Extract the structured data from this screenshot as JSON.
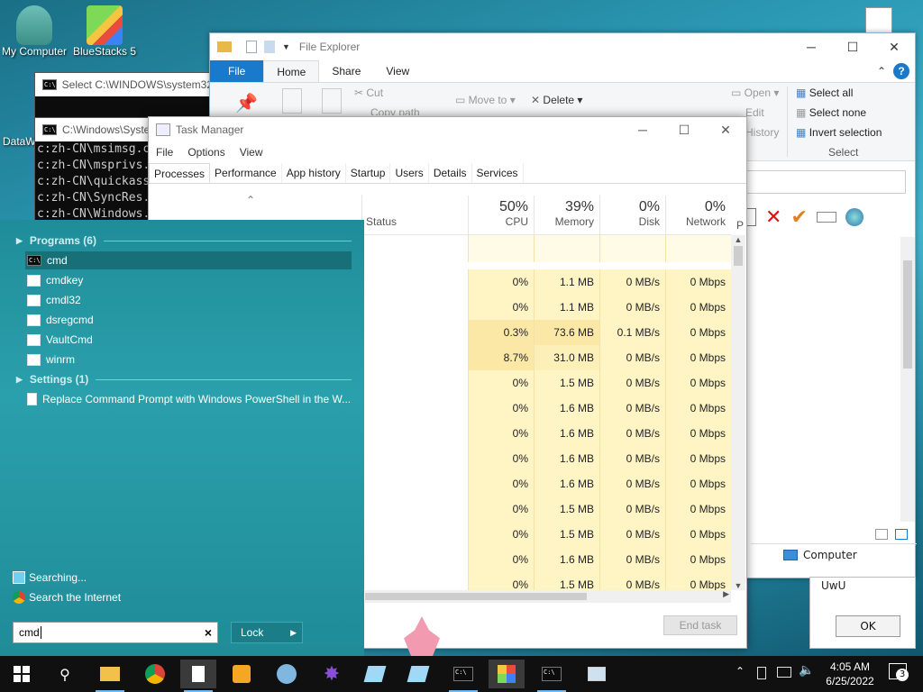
{
  "desktop": {
    "icons": [
      {
        "label": "My Computer"
      },
      {
        "label": "BlueStacks 5"
      },
      {
        "label": "DataW"
      }
    ]
  },
  "console_select": {
    "title": "Select C:\\WINDOWS\\system32\\"
  },
  "console_main": {
    "title": "C:\\Windows\\Syste",
    "lines": [
      "c:zh-CN\\msimsg.c",
      "c:zh-CN\\msprivs.",
      "c:zh-CN\\quickass",
      "c:zh-CN\\SyncRes.",
      "c:zh-CN\\Windows."
    ]
  },
  "explorer": {
    "title": "File Explorer",
    "tabs": {
      "file": "File",
      "home": "Home",
      "share": "Share",
      "view": "View"
    },
    "ribbon": {
      "cut": "Cut",
      "copy_path": "Copy path",
      "move_to": "Move to",
      "delete": "Delete",
      "open": "Open",
      "edit": "Edit",
      "history": "History",
      "select_all": "Select all",
      "select_none": "Select none",
      "invert_selection": "Invert selection",
      "select_group": "Select"
    },
    "nav_computer": "Computer"
  },
  "task_manager": {
    "title": "Task Manager",
    "menu": {
      "file": "File",
      "options": "Options",
      "view": "View"
    },
    "tabs": [
      "Processes",
      "Performance",
      "App history",
      "Startup",
      "Users",
      "Details",
      "Services"
    ],
    "columns": {
      "status": "Status",
      "cpu": {
        "pct": "50%",
        "name": "CPU"
      },
      "memory": {
        "pct": "39%",
        "name": "Memory"
      },
      "disk": {
        "pct": "0%",
        "name": "Disk"
      },
      "network": {
        "pct": "0%",
        "name": "Network"
      },
      "power": "P"
    },
    "rows": [
      {
        "cpu": "",
        "mem": "",
        "disk": "",
        "net": ""
      },
      {
        "cpu": "0%",
        "mem": "1.1 MB",
        "disk": "0 MB/s",
        "net": "0 Mbps"
      },
      {
        "cpu": "0%",
        "mem": "1.1 MB",
        "disk": "0 MB/s",
        "net": "0 Mbps"
      },
      {
        "cpu": "0.3%",
        "mem": "73.6 MB",
        "disk": "0.1 MB/s",
        "net": "0 Mbps"
      },
      {
        "cpu": "8.7%",
        "mem": "31.0 MB",
        "disk": "0 MB/s",
        "net": "0 Mbps"
      },
      {
        "cpu": "0%",
        "mem": "1.5 MB",
        "disk": "0 MB/s",
        "net": "0 Mbps"
      },
      {
        "cpu": "0%",
        "mem": "1.6 MB",
        "disk": "0 MB/s",
        "net": "0 Mbps"
      },
      {
        "cpu": "0%",
        "mem": "1.6 MB",
        "disk": "0 MB/s",
        "net": "0 Mbps"
      },
      {
        "cpu": "0%",
        "mem": "1.6 MB",
        "disk": "0 MB/s",
        "net": "0 Mbps"
      },
      {
        "cpu": "0%",
        "mem": "1.6 MB",
        "disk": "0 MB/s",
        "net": "0 Mbps"
      },
      {
        "cpu": "0%",
        "mem": "1.5 MB",
        "disk": "0 MB/s",
        "net": "0 Mbps"
      },
      {
        "cpu": "0%",
        "mem": "1.5 MB",
        "disk": "0 MB/s",
        "net": "0 Mbps"
      },
      {
        "cpu": "0%",
        "mem": "1.6 MB",
        "disk": "0 MB/s",
        "net": "0 Mbps"
      },
      {
        "cpu": "0%",
        "mem": "1.5 MB",
        "disk": "0 MB/s",
        "net": "0 Mbps"
      }
    ],
    "end_task": "End task"
  },
  "start_search": {
    "programs_header": "Programs (6)",
    "programs": [
      "cmd",
      "cmdkey",
      "cmdl32",
      "dsregcmd",
      "VaultCmd",
      "winrm"
    ],
    "settings_header": "Settings (1)",
    "settings": [
      "Replace Command Prompt with Windows PowerShell in the W..."
    ],
    "searching": "Searching...",
    "search_internet": "Search the Internet",
    "query": "cmd",
    "clear": "×",
    "lock": "Lock"
  },
  "dialog": {
    "text": "UwU",
    "ok": "OK"
  },
  "taskbar": {
    "time": "4:05 AM",
    "date": "6/25/2022",
    "notifications": "3"
  },
  "colors": {
    "accent": "#1979ca",
    "start_panel": "#1f8d99",
    "cpu_heat": "#fff4c4",
    "taskbar": "#101010"
  }
}
